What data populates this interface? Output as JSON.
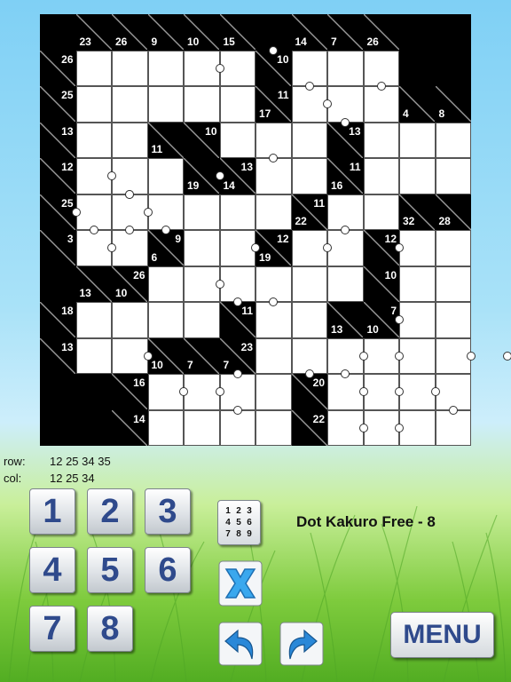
{
  "board": {
    "rows": [
      [
        "B",
        "B|23",
        "B|26",
        "B|9",
        "B|10",
        "B|15",
        "B",
        "B|14",
        "B|7",
        "B|26",
        "B",
        "B"
      ],
      [
        "B26|",
        "W",
        "W",
        "W",
        "W",
        "W",
        "B10|",
        "W",
        "W",
        "W",
        "B",
        "B"
      ],
      [
        "B25|",
        "W",
        "W",
        "W",
        "W",
        "W",
        "B11|17",
        "W",
        "W",
        "W",
        "B|4",
        "B|8"
      ],
      [
        "B13|",
        "W",
        "W",
        "B|11",
        "B10|",
        "W",
        "W",
        "W",
        "B13|",
        "W",
        "W",
        "W"
      ],
      [
        "B12|",
        "W",
        "W",
        "W",
        "B|19",
        "B13|14",
        "W",
        "W",
        "B11|16",
        "W",
        "W",
        "W"
      ],
      [
        "B25|",
        "W",
        "W",
        "W",
        "W",
        "W",
        "W",
        "B11|22",
        "W",
        "W",
        "B|32",
        "B|28"
      ],
      [
        "B3|",
        "W",
        "W",
        "B9|6",
        "W",
        "W",
        "B12|19",
        "W",
        "W",
        "B12|",
        "W",
        "W"
      ],
      [
        "B",
        "B|13",
        "B26|10",
        "W",
        "W",
        "W",
        "W",
        "W",
        "W",
        "B10|",
        "W",
        "W"
      ],
      [
        "B18|",
        "W",
        "W",
        "W",
        "W",
        "B11|",
        "W",
        "W",
        "B|13",
        "B7|10",
        "W",
        "W"
      ],
      [
        "B13|",
        "W",
        "W",
        "B|10",
        "B|7",
        "B23|7",
        "W",
        "W",
        "W",
        "W",
        "W",
        "W"
      ],
      [
        "B",
        "B",
        "B16|",
        "W",
        "W",
        "W",
        "W",
        "B20|",
        "W",
        "W",
        "W",
        "W"
      ],
      [
        "B",
        "B",
        "B14|",
        "W",
        "W",
        "W",
        "W",
        "B22|",
        "W",
        "W",
        "W",
        "W"
      ]
    ],
    "dot_marks": [
      [
        4,
        1,
        2
      ],
      [
        6,
        1,
        1
      ],
      [
        7,
        2,
        1
      ],
      [
        7,
        2,
        2
      ],
      [
        9,
        2,
        1
      ],
      [
        8,
        3,
        1
      ],
      [
        6,
        4,
        1
      ],
      [
        2,
        4,
        3
      ],
      [
        4,
        4,
        2
      ],
      [
        1,
        4,
        2
      ],
      [
        7,
        6,
        2
      ],
      [
        2,
        5,
        1
      ],
      [
        2,
        5,
        2
      ],
      [
        1,
        5,
        4
      ],
      [
        1,
        6,
        1
      ],
      [
        2,
        6,
        1
      ],
      [
        2,
        6,
        4
      ],
      [
        3,
        6,
        1
      ],
      [
        6,
        6,
        4
      ],
      [
        8,
        6,
        1
      ],
      [
        9,
        6,
        2
      ],
      [
        5,
        7,
        3
      ],
      [
        5,
        7,
        4
      ],
      [
        6,
        8,
        1
      ],
      [
        10,
        8,
        4
      ],
      [
        2,
        9,
        2
      ],
      [
        7,
        9,
        3
      ],
      [
        8,
        9,
        2
      ],
      [
        9,
        9,
        2
      ],
      [
        8,
        10,
        1
      ],
      [
        9,
        10,
        4
      ],
      [
        9,
        10,
        2
      ],
      [
        11,
        9,
        2
      ],
      [
        12,
        9,
        2
      ],
      [
        11,
        10,
        4
      ],
      [
        3,
        10,
        2
      ],
      [
        5,
        10,
        1
      ],
      [
        5,
        10,
        4
      ],
      [
        5,
        11,
        1
      ],
      [
        9,
        11,
        4
      ],
      [
        10,
        11,
        4
      ],
      [
        11,
        11,
        1
      ]
    ]
  },
  "hints": {
    "row_label": "row:",
    "row_values": "12 25 34 35",
    "col_label": "col:",
    "col_values": "12 25 34"
  },
  "keypad": {
    "keys": [
      "1",
      "2",
      "3",
      "4",
      "5",
      "6",
      "7",
      "8"
    ]
  },
  "toolbar": {
    "pencil_grid": [
      [
        "1",
        "2",
        "3"
      ],
      [
        "4",
        "5",
        "6"
      ],
      [
        "7",
        "8",
        "9"
      ]
    ],
    "clear_icon": "x-icon",
    "undo_icon": "undo-arrow-icon",
    "redo_icon": "redo-arrow-icon"
  },
  "title": "Dot Kakuro Free - 8",
  "menu_label": "MENU",
  "colors": {
    "number_blue": "#2f4a8c",
    "undo_blue": "#2a88d8",
    "clear_blue": "#3aa8ee"
  }
}
